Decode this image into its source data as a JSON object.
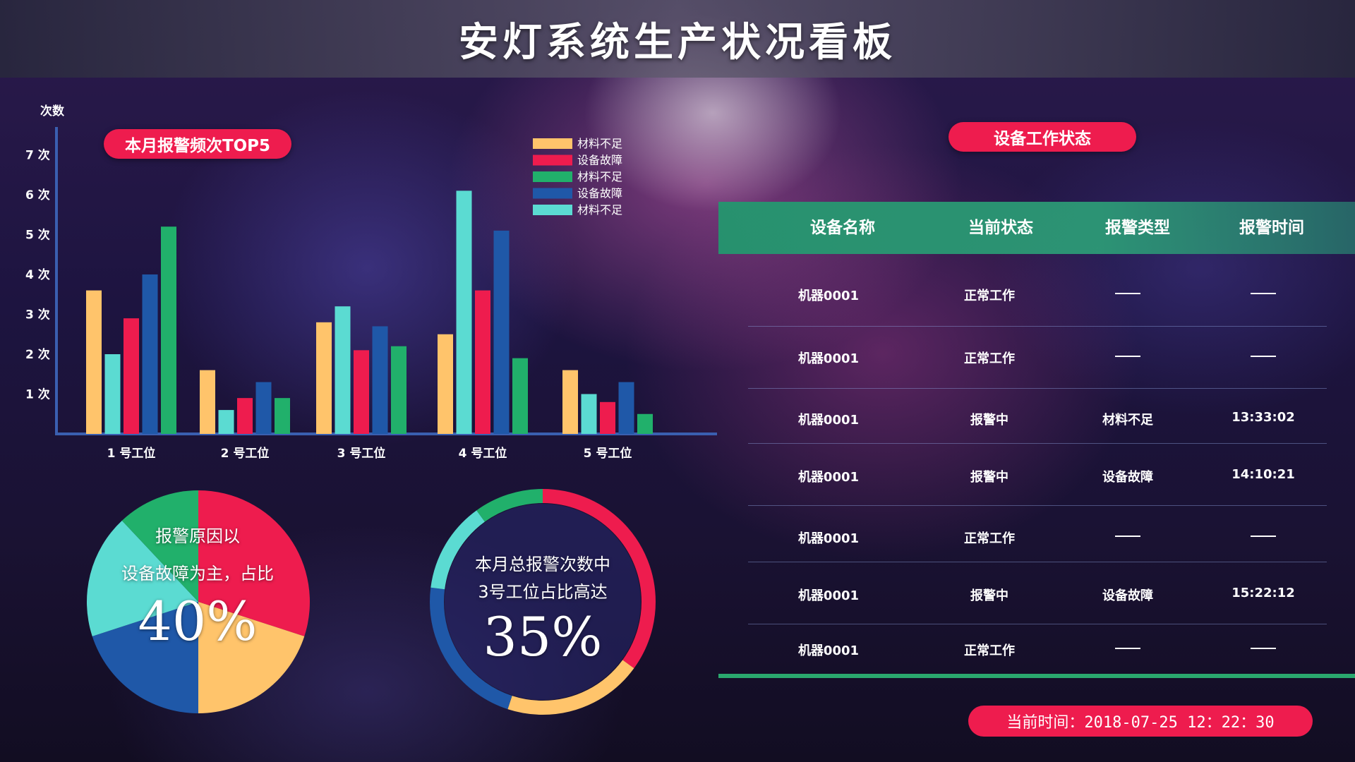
{
  "header": {
    "title": "安灯系统生产状况看板"
  },
  "left_panel": {
    "badge": "本月报警频次TOP5"
  },
  "chart_data": {
    "type": "bar",
    "title": "本月报警频次TOP5",
    "ylabel": "次数",
    "ylim": [
      0,
      8
    ],
    "y_ticks": [
      "1 次",
      "2 次",
      "3 次",
      "4 次",
      "5 次",
      "6 次",
      "7 次"
    ],
    "categories": [
      "1 号工位",
      "2 号工位",
      "3 号工位",
      "4 号工位",
      "5 号工位"
    ],
    "series": [
      {
        "name": "材料不足",
        "color": "#ffc46b",
        "values": [
          3.6,
          1.6,
          2.8,
          2.5,
          1.6
        ]
      },
      {
        "name": "材料不足",
        "color": "#5bdbd2",
        "values": [
          2.0,
          0.6,
          3.2,
          6.1,
          1.0
        ]
      },
      {
        "name": "设备故障",
        "color": "#ee1c4e",
        "values": [
          2.9,
          0.9,
          2.1,
          3.6,
          0.8
        ]
      },
      {
        "name": "设备故障",
        "color": "#1f58a8",
        "values": [
          4.0,
          1.3,
          2.7,
          5.1,
          1.3
        ]
      },
      {
        "name": "材料不足",
        "color": "#21b06b",
        "values": [
          5.2,
          0.9,
          2.2,
          1.9,
          0.5
        ]
      }
    ],
    "legend": [
      {
        "name": "材料不足",
        "color": "#ffc46b"
      },
      {
        "name": "设备故障",
        "color": "#ee1c4e"
      },
      {
        "name": "材料不足",
        "color": "#21b06b"
      },
      {
        "name": "设备故障",
        "color": "#1f58a8"
      },
      {
        "name": "材料不足",
        "color": "#5bdbd2"
      }
    ],
    "legend_position": "top-right",
    "grid": false
  },
  "pie": {
    "line1": "报警原因以",
    "line2": "设备故障为主，占比",
    "percent": "40%",
    "slices": [
      {
        "color": "#ee1c4e",
        "value": 30
      },
      {
        "color": "#ffc46b",
        "value": 20
      },
      {
        "color": "#1f58a8",
        "value": 20
      },
      {
        "color": "#5bdbd2",
        "value": 18
      },
      {
        "color": "#21b06b",
        "value": 12
      }
    ]
  },
  "donut": {
    "line1": "本月总报警次数中",
    "line2": "3号工位占比高达",
    "percent": "35%",
    "segments": [
      {
        "color": "#ee1c4e",
        "value": 35
      },
      {
        "color": "#ffc46b",
        "value": 20
      },
      {
        "color": "#1f58a8",
        "value": 22
      },
      {
        "color": "#5bdbd2",
        "value": 13
      },
      {
        "color": "#21b06b",
        "value": 10
      }
    ]
  },
  "right_panel": {
    "badge": "设备工作状态"
  },
  "table": {
    "columns": [
      "设备名称",
      "当前状态",
      "报警类型",
      "报警时间"
    ],
    "rows": [
      {
        "name": "机器0001",
        "status": "正常工作",
        "type": "",
        "time": ""
      },
      {
        "name": "机器0001",
        "status": "正常工作",
        "type": "",
        "time": ""
      },
      {
        "name": "机器0001",
        "status": "报警中",
        "type": "材料不足",
        "time": "13:33:02"
      },
      {
        "name": "机器0001",
        "status": "报警中",
        "type": "设备故障",
        "time": "14:10:21"
      },
      {
        "name": "机器0001",
        "status": "正常工作",
        "type": "",
        "time": ""
      },
      {
        "name": "机器0001",
        "status": "报警中",
        "type": "设备故障",
        "time": "15:22:12"
      },
      {
        "name": "机器0001",
        "status": "正常工作",
        "type": "",
        "time": ""
      }
    ]
  },
  "footer": {
    "clock": "当前时间：2018-07-25 12：22：30"
  }
}
